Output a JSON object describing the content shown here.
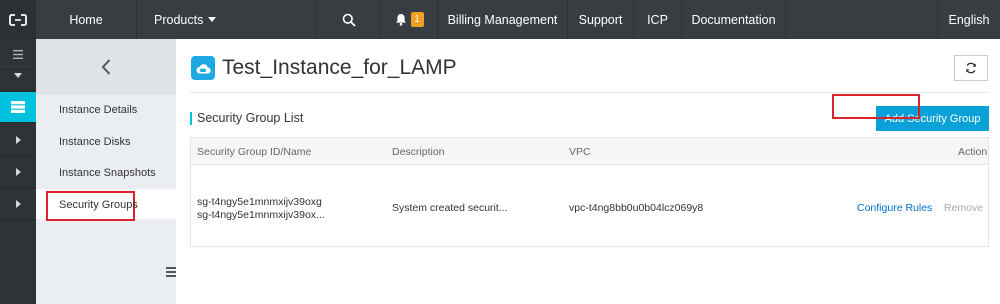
{
  "topnav": {
    "home": "Home",
    "products": "Products",
    "notification_count": "1",
    "billing": "Billing Management",
    "support": "Support",
    "icp": "ICP",
    "documentation": "Documentation",
    "language": "English"
  },
  "icons": {
    "logo": "aliyun-logo-icon",
    "search": "search-icon",
    "bell": "bell-icon",
    "back": "chevron-left-icon",
    "refresh": "refresh-icon",
    "instance": "cloud-instance-icon"
  },
  "colors": {
    "accent": "#00c1de",
    "primary_button": "#0aa1d8",
    "highlight_box": "#d9232d",
    "link": "#0070cc",
    "badge": "#f0a020"
  },
  "sidebar": {
    "items": [
      {
        "label": "Instance Details"
      },
      {
        "label": "Instance Disks"
      },
      {
        "label": "Instance Snapshots"
      },
      {
        "label": "Security Groups"
      }
    ]
  },
  "page": {
    "title": "Test_Instance_for_LAMP"
  },
  "security_groups": {
    "title": "Security Group List",
    "add_button": "Add Security Group",
    "columns": [
      "Security Group ID/Name",
      "Description",
      "VPC",
      "Action"
    ],
    "rows": [
      {
        "id": "sg-t4ngy5e1mnmxijv39oxg",
        "name": "sg-t4ngy5e1mnmxijv39ox...",
        "description": "System created securit...",
        "vpc": "vpc-t4ng8bb0u0b04lcz069y8",
        "action_configure": "Configure Rules",
        "action_remove": "Remove"
      }
    ]
  }
}
